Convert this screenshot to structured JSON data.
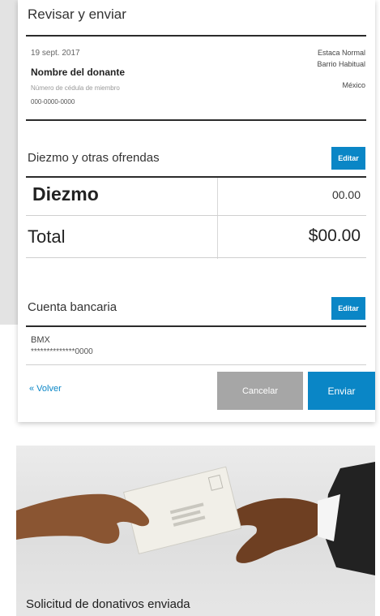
{
  "review": {
    "title": "Revisar y enviar",
    "date": "19 sept. 2017",
    "donor_name": "Nombre del donante",
    "member_label": "Número de cédula de miembro",
    "member_number": "000-0000-0000",
    "ward_line1": "Estaca Normal",
    "ward_line2": "Barrio Habitual",
    "country": "México"
  },
  "offerings": {
    "section_title": "Diezmo y otras ofrendas",
    "edit_label": "Editar",
    "item_label": "Diezmo",
    "item_amount": "00.00",
    "total_label": "Total",
    "total_amount": "$00.00"
  },
  "bank": {
    "section_title": "Cuenta bancaria",
    "edit_label": "Editar",
    "bank_name": "BMX",
    "account_masked": "**************0000"
  },
  "actions": {
    "back_label": "« Volver",
    "cancel_label": "Cancelar",
    "send_label": "Enviar"
  },
  "confirmation": {
    "caption": "Solicitud de donativos enviada"
  },
  "colors": {
    "accent": "#0a86c6",
    "cancel_gray": "#a6a6a6"
  }
}
